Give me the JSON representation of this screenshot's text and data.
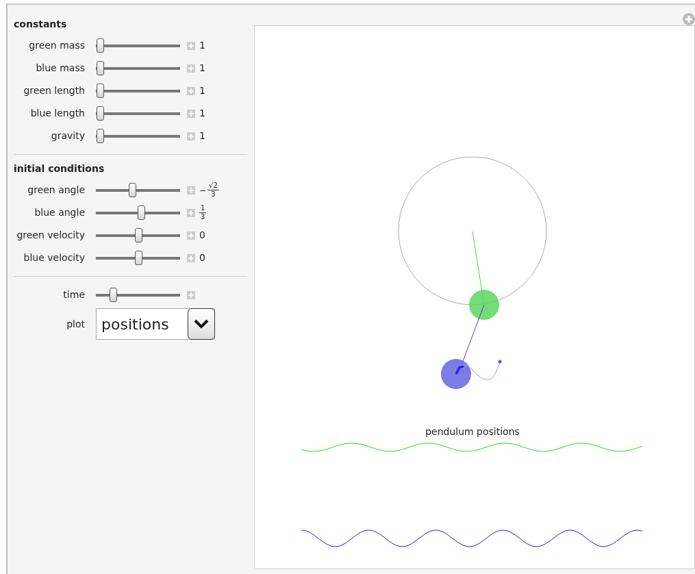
{
  "sections": [
    {
      "title": "constants",
      "controls": [
        {
          "kind": "slider",
          "label": "green mass",
          "level": 0.05,
          "value": {
            "kind": "text",
            "text": "1"
          }
        },
        {
          "kind": "slider",
          "label": "blue mass",
          "level": 0.05,
          "value": {
            "kind": "text",
            "text": "1"
          }
        },
        {
          "kind": "slider",
          "label": "green length",
          "level": 0.05,
          "value": {
            "kind": "text",
            "text": "1"
          }
        },
        {
          "kind": "slider",
          "label": "blue length",
          "level": 0.05,
          "value": {
            "kind": "text",
            "text": "1"
          }
        },
        {
          "kind": "slider",
          "label": "gravity",
          "level": 0.05,
          "value": {
            "kind": "text",
            "text": "1"
          }
        }
      ]
    },
    {
      "title": "initial conditions",
      "controls": [
        {
          "kind": "slider",
          "label": "green angle",
          "level": 0.43,
          "value": {
            "kind": "fraction",
            "sign": "−",
            "numerator": "√2",
            "denominator": "3"
          }
        },
        {
          "kind": "slider",
          "label": "blue angle",
          "level": 0.54,
          "value": {
            "kind": "fraction",
            "numerator": "1",
            "denominator": "3"
          }
        },
        {
          "kind": "slider",
          "label": "green velocity",
          "level": 0.5,
          "value": {
            "kind": "text",
            "text": "0"
          }
        },
        {
          "kind": "slider",
          "label": "blue velocity",
          "level": 0.5,
          "value": {
            "kind": "text",
            "text": "0"
          }
        }
      ]
    },
    {
      "controls": [
        {
          "kind": "slider",
          "label": "time",
          "level": 0.2
        },
        {
          "kind": "dropdown",
          "label": "plot",
          "value": "positions"
        }
      ]
    }
  ],
  "plot": {
    "title": "pendulum positions"
  }
}
